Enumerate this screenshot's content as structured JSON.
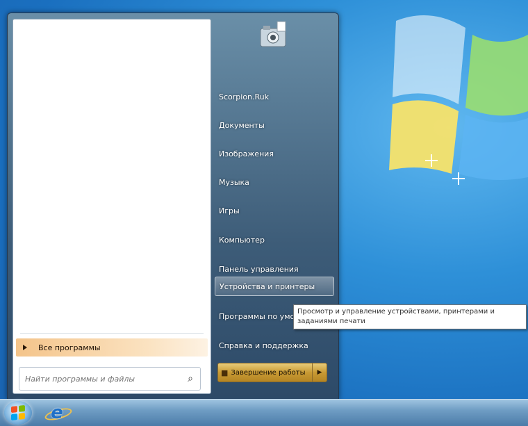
{
  "start_menu": {
    "all_programs_label": "Все программы",
    "search_placeholder": "Найти программы и файлы",
    "right_items": [
      {
        "label": "Scorpion.Ruk"
      },
      {
        "label": "Документы"
      },
      {
        "label": "Изображения"
      },
      {
        "label": "Музыка"
      },
      {
        "label": "Игры"
      },
      {
        "label": "Компьютер"
      },
      {
        "label": "Панель управления"
      },
      {
        "label": "Устройства и принтеры",
        "highlighted": true
      },
      {
        "label": "Программы по умолчанию"
      },
      {
        "label": "Справка и поддержка"
      }
    ],
    "shutdown_label": "Завершение работы"
  },
  "tooltip": {
    "text": "Просмотр и управление устройствами, принтерами и заданиями печати"
  },
  "icons": {
    "search": "search-icon",
    "user_picture": "user-picture-icon",
    "start": "windows-logo-icon",
    "ie": "internet-explorer-icon",
    "shutdown_arrow": "chevron-right-icon"
  },
  "colors": {
    "desktop_blue": "#2e90d8",
    "menu_dark": "#3d5c78",
    "highlight_orange": "#f4c48a",
    "shutdown_gold": "#c89a34"
  }
}
